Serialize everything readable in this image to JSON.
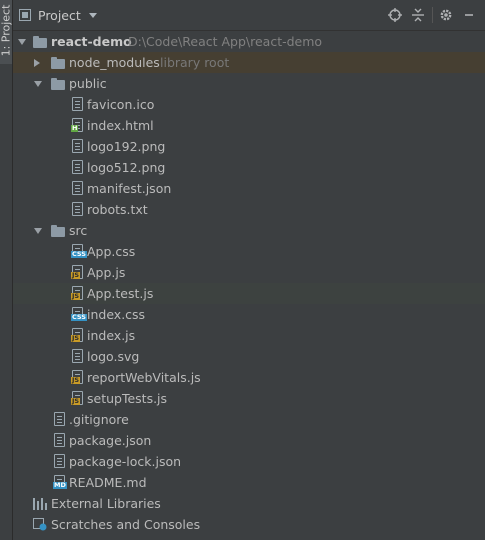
{
  "side_tab": {
    "label": "1: Project"
  },
  "header": {
    "title": "Project"
  },
  "tree": {
    "root": {
      "name": "react-demo",
      "path": "D:\\Code\\React App\\react-demo"
    },
    "node_modules": {
      "name": "node_modules",
      "note": "library root"
    },
    "public": {
      "name": "public",
      "files": [
        "favicon.ico",
        "index.html",
        "logo192.png",
        "logo512.png",
        "manifest.json",
        "robots.txt"
      ]
    },
    "src": {
      "name": "src",
      "files": [
        "App.css",
        "App.js",
        "App.test.js",
        "index.css",
        "index.js",
        "logo.svg",
        "reportWebVitals.js",
        "setupTests.js"
      ]
    },
    "root_files": [
      ".gitignore",
      "package.json",
      "package-lock.json",
      "README.md"
    ],
    "external_libraries": "External Libraries",
    "scratches": "Scratches and Consoles"
  },
  "badges": {
    "js": "JS",
    "css": "CSS",
    "html": "H",
    "md": "MD"
  },
  "colors": {
    "background": "#3c3f41",
    "selection": "#463f32",
    "highlight": "#3d4240"
  }
}
